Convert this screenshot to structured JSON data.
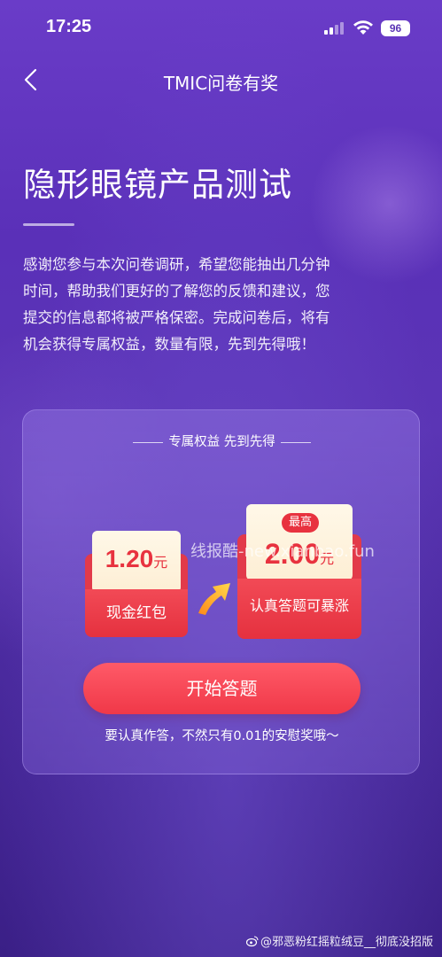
{
  "status_bar": {
    "time": "17:25",
    "battery": "96"
  },
  "nav": {
    "title": "TMIC问卷有奖"
  },
  "page": {
    "title": "隐形眼镜产品测试",
    "intro_lines": [
      "感谢您参与本次问卷调研，希望您能抽出几分钟",
      "时间，帮助我们更好的了解您的反馈和建议，您",
      "提交的信息都将被严格保密。完成问卷后，将有",
      "机会获得专属权益，数量有限，先到先得哦！"
    ]
  },
  "card": {
    "header": "专属权益 先到先得",
    "reward_small": {
      "amount": "1.20",
      "unit": "元",
      "label": "现金红包"
    },
    "reward_big": {
      "tag": "最高",
      "amount": "2.00",
      "unit": "元",
      "label": "认真答题可暴涨"
    },
    "start_button": "开始答题",
    "note": "要认真作答，不然只有0.01的安慰奖哦～"
  },
  "watermarks": {
    "center": "线报酷-new.xianbao.fun",
    "bottom": "@邪恶粉红摇粒绒豆__彻底没招版"
  },
  "colors": {
    "background": "#5b35b5",
    "accent": "#f03848",
    "envelope": "#e5313f"
  }
}
